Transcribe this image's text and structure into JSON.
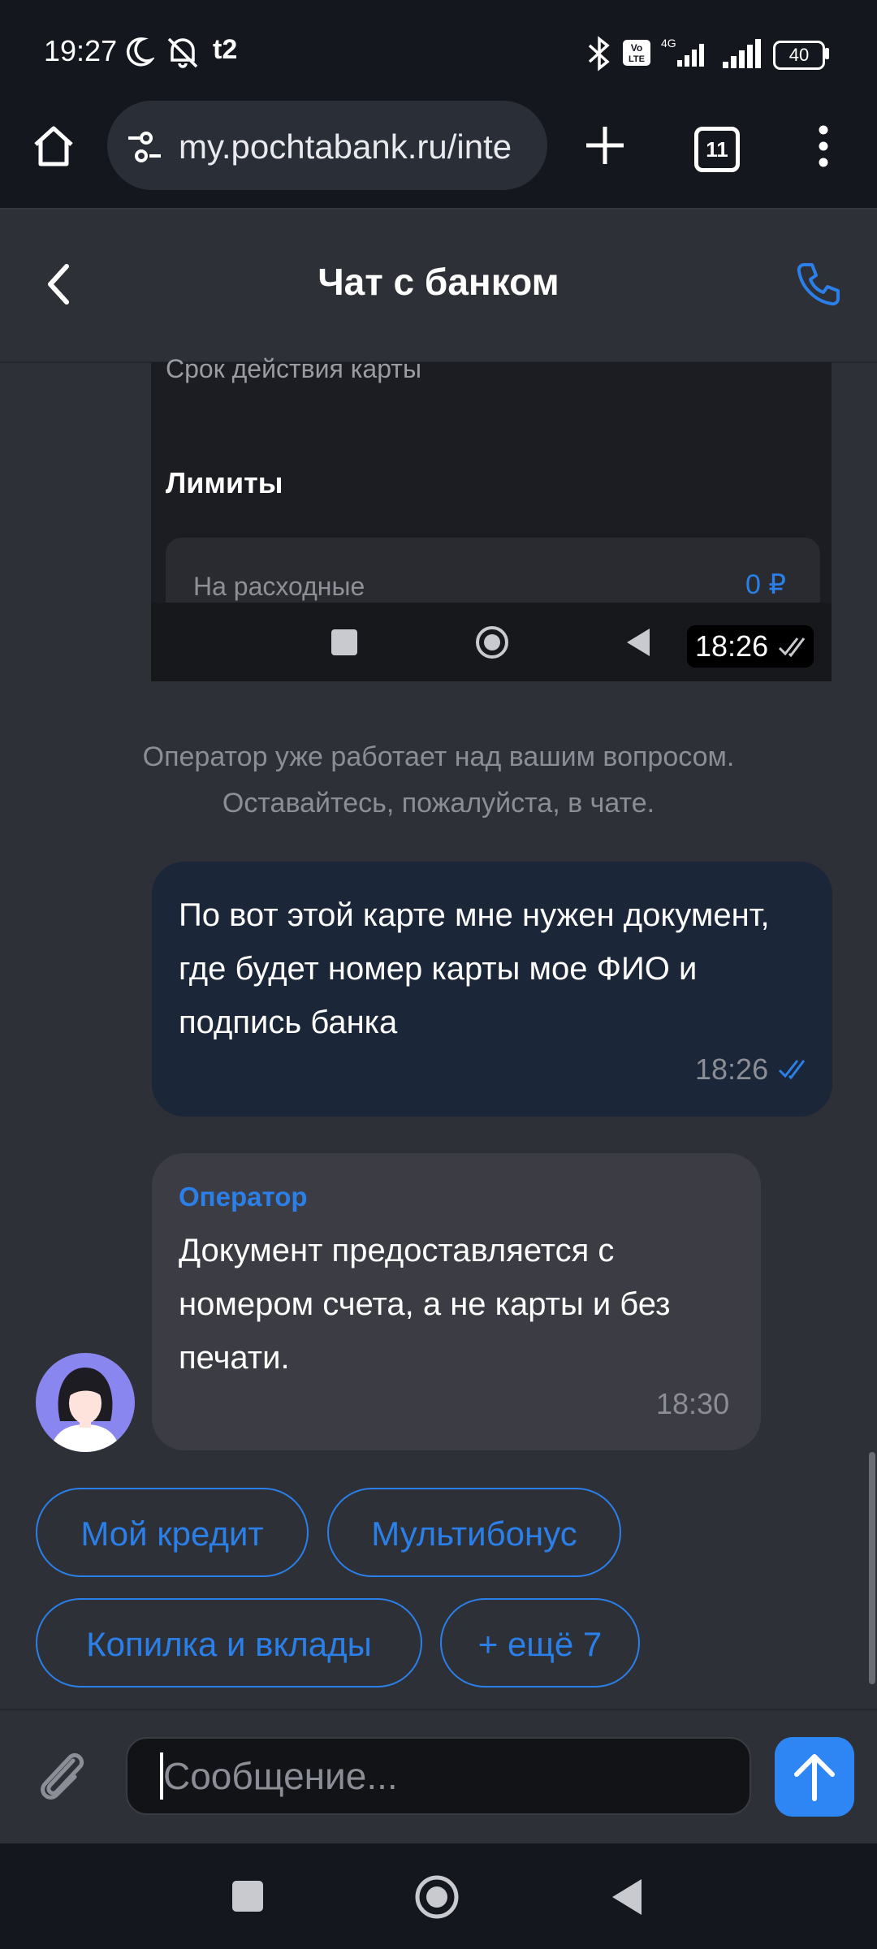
{
  "status_bar": {
    "time": "19:27",
    "carrier": "t2",
    "battery": "40"
  },
  "browser": {
    "url": "my.pochtabank.ru/inte",
    "tab_count": "11"
  },
  "header": {
    "title": "Чат с банком"
  },
  "card_screenshot": {
    "expiry_label": "Срок действия карты",
    "limits_title": "Лимиты",
    "limit_label": "На расходные",
    "limit_value": "0 ₽",
    "time": "18:26"
  },
  "notice": "Оператор уже работает над вашим вопросом. Оставайтесь, пожалуйста, в чате.",
  "messages": [
    {
      "sender": "user",
      "text": "По вот этой карте мне нужен документ, где будет номер карты мое ФИО и подпись банка",
      "time": "18:26"
    },
    {
      "sender": "operator",
      "name": "Оператор",
      "text": "Документ предоставляется с номером счета, а не карты и без печати.",
      "time": "18:30"
    }
  ],
  "chips": [
    "Мой кредит",
    "Мультибонус",
    "Копилка и вклады",
    "+ ещё 7"
  ],
  "input": {
    "placeholder": "Сообщение..."
  },
  "colors": {
    "accent": "#2b7fe8",
    "background": "#2e3037",
    "user_bubble": "#1b2638",
    "operator_bubble": "#3b3c44"
  }
}
